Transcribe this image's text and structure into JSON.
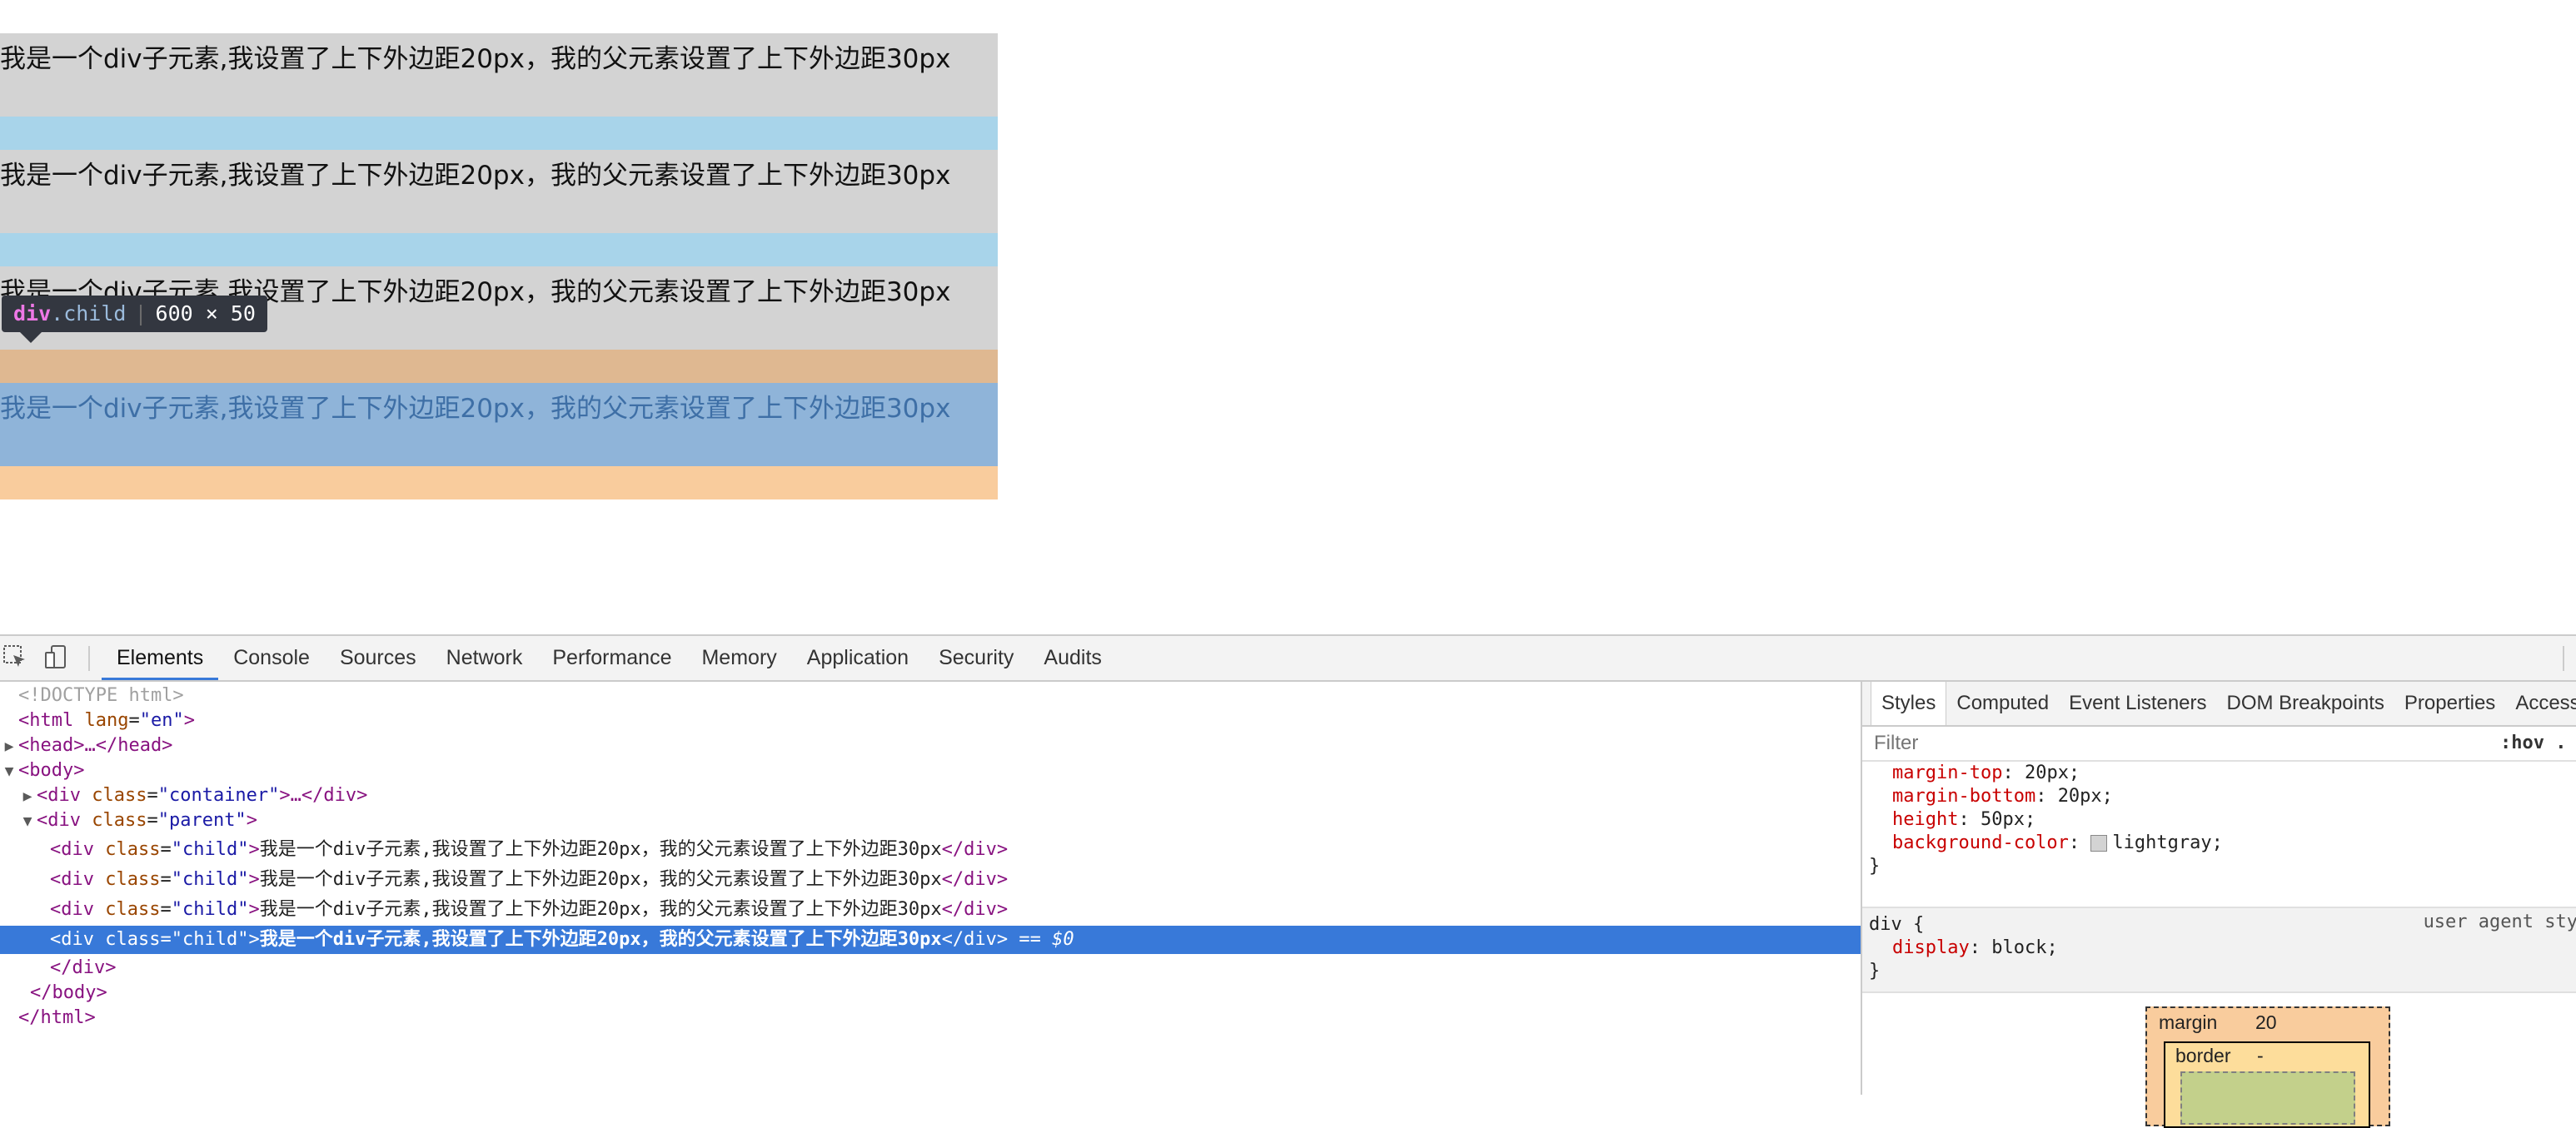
{
  "page": {
    "child_text": "我是一个div子元素,我设置了上下外边距20px，我的父元素设置了上下外边距30px",
    "rows": [
      {
        "text": "我是一个div子元素,我设置了上下外边距20px，我的父元素设置了上下外边距30px"
      },
      {
        "text": "我是一个div子元素,我设置了上下外边距20px，我的父元素设置了上下外边距30px"
      },
      {
        "text": "我是一个div子元素,我设置了上下外边距20px，我的父元素设置了上下外边距30px"
      },
      {
        "text": "我是一个div子元素,我设置了上下外边距20px，我的父元素设置了上下外边距30px"
      }
    ],
    "colors": {
      "child_bg": "#d3d3d3",
      "margin_band": "#a8d4ea",
      "highlight": "#8fb4d9",
      "margin_highlight": "#f9cc9d"
    }
  },
  "tooltip": {
    "tag": "div",
    "cls": ".child",
    "size": "600 × 50"
  },
  "toolbar": {
    "inspect_icon": "inspect-element-icon",
    "device_icon": "device-toggle-icon",
    "tabs": [
      "Elements",
      "Console",
      "Sources",
      "Network",
      "Performance",
      "Memory",
      "Application",
      "Security",
      "Audits"
    ]
  },
  "dom": {
    "doctype": "<!DOCTYPE html>",
    "html_open_tag": "<html",
    "html_lang_attr": "lang",
    "html_lang_val": "\"en\"",
    "close_gt": ">",
    "head": "<head>…</head>",
    "body_open": "<body>",
    "div_open": "<div",
    "class_attr": "class",
    "eq": "=",
    "container_val": "\"container\"",
    "container_close": ">…</div>",
    "parent_val": "\"parent\"",
    "child_val": "\"child\"",
    "child_text": "我是一个div子元素,我设置了上下外边距20px，我的父元素设置了上下外边距30px",
    "div_close": "</div>",
    "selected_marker": "== $0",
    "body_close": "</body>",
    "html_close": "</html>"
  },
  "sidebar": {
    "tabs": [
      "Styles",
      "Computed",
      "Event Listeners",
      "DOM Breakpoints",
      "Properties",
      "Accessibi"
    ],
    "filter_placeholder": "Filter",
    "hov": ":hov .",
    "rule1": {
      "margin_top_name": "margin-top",
      "margin_top_value": "20px;",
      "margin_bottom_name": "margin-bottom",
      "margin_bottom_value": "20px;",
      "height_name": "height",
      "height_value": "50px;",
      "bg_name": "background-color",
      "bg_value": "lightgray;",
      "close": "}"
    },
    "rule2": {
      "selector": "div {",
      "source": "user agent sty",
      "display_name": "display",
      "display_value": "block;",
      "close": "}"
    },
    "box_model": {
      "margin_label": "margin",
      "margin_value": "20",
      "border_label": "border",
      "border_value": "-"
    }
  }
}
